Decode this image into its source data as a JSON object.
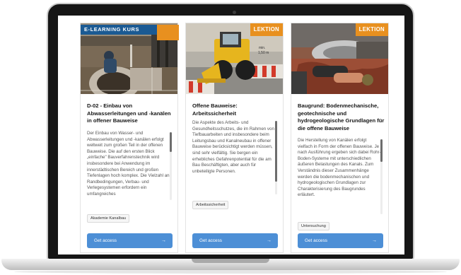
{
  "colors": {
    "brand_blue": "#1b5a93",
    "accent_orange": "#e8901f",
    "button_blue": "#4d8fd6"
  },
  "cards": [
    {
      "badge": "E-LEARNING KURS",
      "title": "D-02 - Einbau von Abwasserleitungen und -kanälen in offener Bauweise",
      "description": "Der Einbau von Wasser- und Abwasserleitungen und -kanälen erfolgt weltweit zum großen Teil in der offenen Bauweise. Die auf den ersten Blick „einfache\" Bauverfahrenstechnik wird insbesondere bei Anwendung im innerstädtischen Bereich und großen Tiefenlagen hoch komplex. Die Vielzahl an Randbedingungen, Verbau- und Verlegesystemen erfordern ein umfangreiches",
      "tag": "Akademie Kanalbau",
      "button_label": "Get access",
      "button_icon": "arrow-right-icon"
    },
    {
      "badge": "LEKTION",
      "title": "Offene Bauweise: Arbeitssicherheit",
      "description": "Die Aspekte des Arbeits- und Gesundheitsschutzes, die im Rahmen von Tiefbauarbeiten und insbesondere beim Leitungsbau und Kanalneubau in offener Bauweise berücksichtigt werden müssen, sind sehr vielfältig. Sie bergen ein erhebliches Gefahrenpotential für die am Bau Beschäftigten, aber auch für unbeteiligte Personen.",
      "tag": "Arbeitssicherheit",
      "button_label": "Get access",
      "button_icon": "arrow-right-icon"
    },
    {
      "badge": "LEKTION",
      "title": "Baugrund: Bodenmechanische, geotechnische und hydrogeologische Grundlagen für die offene Bauweise",
      "description": "Die Herstellung von Kanälen erfolgt vielfach in Form der offenen Bauweise. Je nach Ausführung ergeben sich dabei Rohr-Boden-Systeme mit unterschiedlichen äußeren Belastungen des Kanals. Zum Verständnis dieser Zusammenhänge werden die bodenmechanischen und hydrogeologischen Grundlagen zur Charakterisierung des Baugrundes erläutert.",
      "tag": "Untersuchung",
      "button_label": "Get access",
      "button_icon": "arrow-right-icon"
    }
  ]
}
